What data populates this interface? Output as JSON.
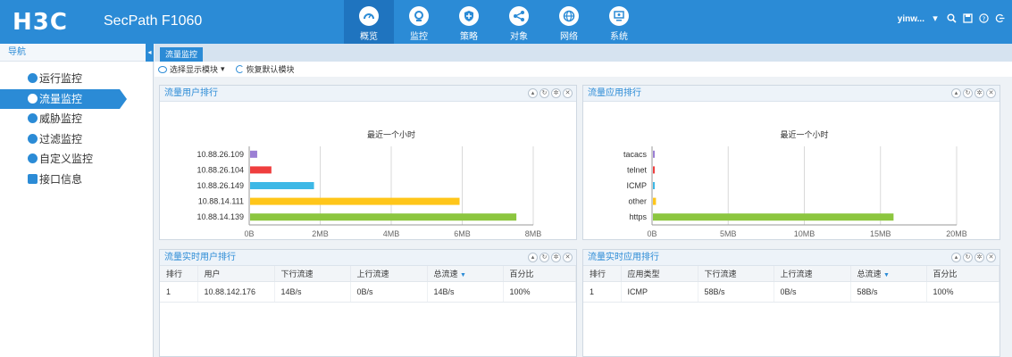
{
  "header": {
    "logo": "H3C",
    "product": "SecPath F1060",
    "nav": [
      {
        "label": "概览",
        "icon": "gauge-icon",
        "active": true
      },
      {
        "label": "监控",
        "icon": "monitor-icon",
        "active": false
      },
      {
        "label": "策略",
        "icon": "shield-icon",
        "active": false
      },
      {
        "label": "对象",
        "icon": "share-icon",
        "active": false
      },
      {
        "label": "网络",
        "icon": "globe-icon",
        "active": false
      },
      {
        "label": "系统",
        "icon": "screen-icon",
        "active": false
      }
    ],
    "user": "yinw..."
  },
  "sidebar": {
    "title": "导航",
    "items": [
      {
        "label": "运行监控",
        "icon": "status-icon",
        "active": false
      },
      {
        "label": "流量监控",
        "icon": "traffic-icon",
        "active": true
      },
      {
        "label": "威胁监控",
        "icon": "threat-icon",
        "active": false
      },
      {
        "label": "过滤监控",
        "icon": "filter-icon",
        "active": false
      },
      {
        "label": "自定义监控",
        "icon": "custom-icon",
        "active": false
      },
      {
        "label": "接口信息",
        "icon": "interface-icon",
        "active": false
      }
    ]
  },
  "tabs": {
    "active": "流量监控"
  },
  "toolbar": {
    "select_modules": "选择显示模块",
    "restore_default": "恢复默认模块"
  },
  "panels": {
    "user_rank": {
      "title": "流量用户排行"
    },
    "app_rank": {
      "title": "流量应用排行"
    },
    "rt_user": {
      "title": "流量实时用户排行"
    },
    "rt_app": {
      "title": "流量实时应用排行"
    }
  },
  "chart_data": [
    {
      "type": "bar",
      "orientation": "horizontal",
      "title": "最近一个小时",
      "categories": [
        "10.88.26.109",
        "10.88.26.104",
        "10.88.26.149",
        "10.88.14.111",
        "10.88.14.139"
      ],
      "values": [
        0.2,
        0.6,
        1.8,
        5.9,
        7.5
      ],
      "value_unit": "MB",
      "colors": [
        "#9b7fd4",
        "#ef3e3e",
        "#3db8e6",
        "#ffc61a",
        "#8cc63f"
      ],
      "xticks": [
        "0B",
        "2MB",
        "4MB",
        "6MB",
        "8MB"
      ],
      "xlim": [
        0,
        8
      ],
      "grid": true
    },
    {
      "type": "bar",
      "orientation": "horizontal",
      "title": "最近一个小时",
      "categories": [
        "tacacs",
        "telnet",
        "ICMP",
        "other",
        "https"
      ],
      "values": [
        0.1,
        0.1,
        0.1,
        0.2,
        15.8
      ],
      "value_unit": "MB",
      "colors": [
        "#9b7fd4",
        "#ef3e3e",
        "#3db8e6",
        "#ffc61a",
        "#8cc63f"
      ],
      "xticks": [
        "0B",
        "5MB",
        "10MB",
        "15MB",
        "20MB"
      ],
      "xlim": [
        0,
        20
      ],
      "grid": true
    }
  ],
  "rt_user_table": {
    "headers": [
      "排行",
      "用户",
      "下行流速",
      "上行流速",
      "总流速",
      "百分比"
    ],
    "rows": [
      [
        "1",
        "10.88.142.176",
        "14B/s",
        "0B/s",
        "14B/s",
        "100%"
      ]
    ]
  },
  "rt_app_table": {
    "headers": [
      "排行",
      "应用类型",
      "下行流速",
      "上行流速",
      "总流速",
      "百分比"
    ],
    "rows": [
      [
        "1",
        "ICMP",
        "58B/s",
        "0B/s",
        "58B/s",
        "100%"
      ]
    ]
  }
}
